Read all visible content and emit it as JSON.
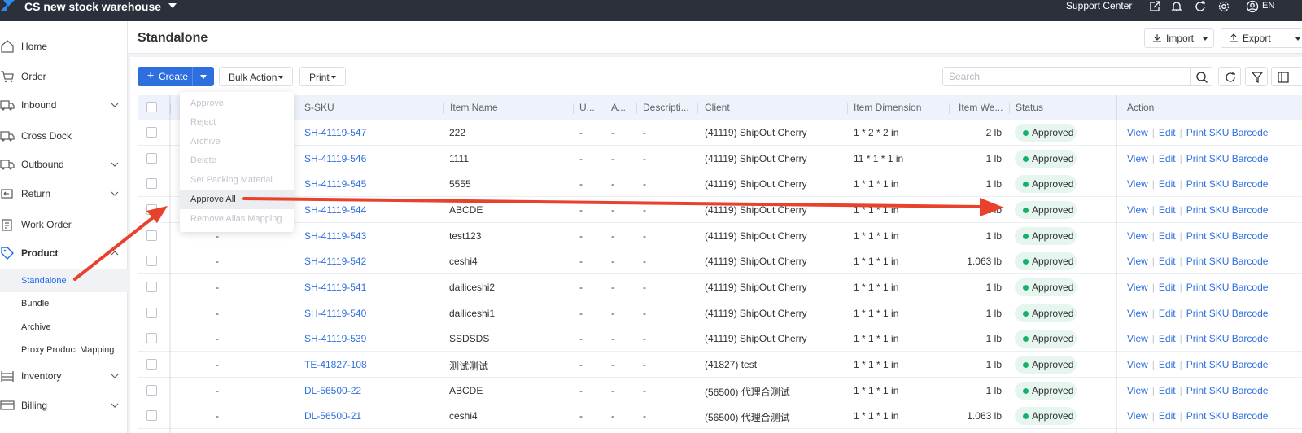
{
  "topbar": {
    "warehouse": "CS new stock warehouse",
    "support": "Support Center",
    "lang": "EN",
    "icons": [
      "logo-icon",
      "external-link-icon",
      "bell-icon",
      "refresh-icon",
      "settings-icon",
      "user-icon"
    ]
  },
  "sidebar": {
    "items": [
      {
        "label": "Home",
        "icon": "home-icon"
      },
      {
        "label": "Order",
        "icon": "cart-icon"
      },
      {
        "label": "Inbound",
        "icon": "truck-icon"
      },
      {
        "label": "Cross Dock",
        "icon": "truck-icon"
      },
      {
        "label": "Outbound",
        "icon": "truck-icon"
      },
      {
        "label": "Return",
        "icon": "return-icon"
      },
      {
        "label": "Work Order",
        "icon": "clipboard-icon"
      },
      {
        "label": "Product",
        "icon": "tag-icon"
      },
      {
        "label": "Inventory",
        "icon": "shelf-icon"
      },
      {
        "label": "Billing",
        "icon": "card-icon"
      }
    ],
    "product_subitems": [
      "Standalone",
      "Bundle",
      "Archive",
      "Proxy Product Mapping"
    ]
  },
  "header": {
    "title": "Standalone",
    "import_label": "Import",
    "export_label": "Export"
  },
  "toolbar": {
    "create_label": "Create",
    "bulk_action_label": "Bulk Action",
    "print_label": "Print",
    "search_placeholder": "Search"
  },
  "bulk_menu": {
    "items": [
      "Approve",
      "Reject",
      "Archive",
      "Delete",
      "Set Packing Material",
      "Approve All",
      "Remove Alias Mapping"
    ],
    "enabled_item": "Approve All"
  },
  "table": {
    "columns": [
      "S-SKU",
      "Item Name",
      "U...",
      "A...",
      "Descripti...",
      "Client",
      "Item Dimension",
      "Item We...",
      "Status",
      "Action"
    ],
    "actions": [
      "View",
      "Edit",
      "Print SKU Barcode"
    ],
    "rows": [
      {
        "prefix": "",
        "sku": "SH-41119-547",
        "name": "222",
        "u": "-",
        "a": "-",
        "desc": "-",
        "client": "(41119) ShipOut Cherry",
        "dim": "1 * 2 * 2 in",
        "weight": "2 lb",
        "status": "Approved"
      },
      {
        "prefix": "",
        "sku": "SH-41119-546",
        "name": "1111",
        "u": "-",
        "a": "-",
        "desc": "-",
        "client": "(41119) ShipOut Cherry",
        "dim": "11 * 1 * 1 in",
        "weight": "1 lb",
        "status": "Approved"
      },
      {
        "prefix": "",
        "sku": "SH-41119-545",
        "name": "5555",
        "u": "-",
        "a": "-",
        "desc": "-",
        "client": "(41119) ShipOut Cherry",
        "dim": "1 * 1 * 1 in",
        "weight": "1 lb",
        "status": "Approved"
      },
      {
        "prefix": "",
        "sku": "SH-41119-544",
        "name": "ABCDE",
        "u": "-",
        "a": "-",
        "desc": "-",
        "client": "(41119) ShipOut Cherry",
        "dim": "1 * 1 * 1 in",
        "weight": "1 lb",
        "status": "Approved"
      },
      {
        "prefix": "-",
        "sku": "SH-41119-543",
        "name": "test123",
        "u": "-",
        "a": "-",
        "desc": "-",
        "client": "(41119) ShipOut Cherry",
        "dim": "1 * 1 * 1 in",
        "weight": "1 lb",
        "status": "Approved"
      },
      {
        "prefix": "-",
        "sku": "SH-41119-542",
        "name": "ceshi4",
        "u": "-",
        "a": "-",
        "desc": "-",
        "client": "(41119) ShipOut Cherry",
        "dim": "1 * 1 * 1 in",
        "weight": "1.063 lb",
        "status": "Approved"
      },
      {
        "prefix": "-",
        "sku": "SH-41119-541",
        "name": "dailiceshi2",
        "u": "-",
        "a": "-",
        "desc": "-",
        "client": "(41119) ShipOut Cherry",
        "dim": "1 * 1 * 1 in",
        "weight": "1 lb",
        "status": "Approved"
      },
      {
        "prefix": "-",
        "sku": "SH-41119-540",
        "name": "dailiceshi1",
        "u": "-",
        "a": "-",
        "desc": "-",
        "client": "(41119) ShipOut Cherry",
        "dim": "1 * 1 * 1 in",
        "weight": "1 lb",
        "status": "Approved"
      },
      {
        "prefix": "-",
        "sku": "SH-41119-539",
        "name": "SSDSDS",
        "u": "-",
        "a": "-",
        "desc": "-",
        "client": "(41119) ShipOut Cherry",
        "dim": "1 * 1 * 1 in",
        "weight": "1 lb",
        "status": "Approved"
      },
      {
        "prefix": "-",
        "sku": "TE-41827-108",
        "name": "测试测试",
        "u": "-",
        "a": "-",
        "desc": "-",
        "client": "(41827) test",
        "dim": "1 * 1 * 1 in",
        "weight": "1 lb",
        "status": "Approved"
      },
      {
        "prefix": "-",
        "sku": "DL-56500-22",
        "name": "ABCDE",
        "u": "-",
        "a": "-",
        "desc": "-",
        "client": "(56500) 代理合测试",
        "dim": "1 * 1 * 1 in",
        "weight": "1 lb",
        "status": "Approved"
      },
      {
        "prefix": "-",
        "sku": "DL-56500-21",
        "name": "ceshi4",
        "u": "-",
        "a": "-",
        "desc": "-",
        "client": "(56500) 代理合测试",
        "dim": "1 * 1 * 1 in",
        "weight": "1.063 lb",
        "status": "Approved"
      }
    ]
  },
  "colors": {
    "accent": "#2e6fe0",
    "topbar": "#2b303b",
    "status_green": "#14b06d",
    "annotation_arrow": "#e8412c"
  }
}
